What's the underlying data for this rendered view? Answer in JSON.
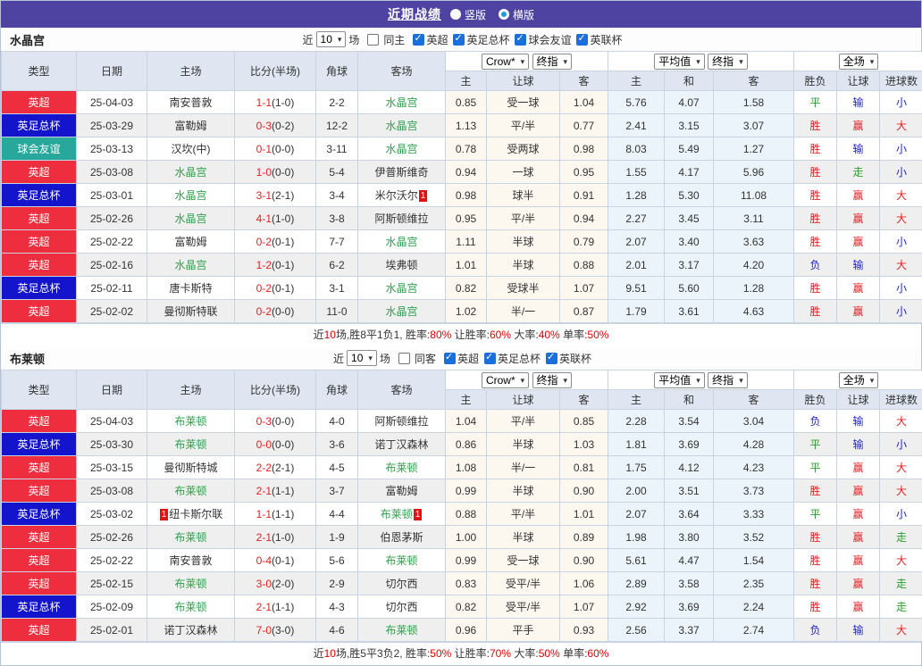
{
  "title_bar": {
    "title": "近期战绩",
    "radios": [
      {
        "label": "竖版",
        "selected": false
      },
      {
        "label": "横版",
        "selected": true
      }
    ]
  },
  "icons": {
    "chevron_down": "▾",
    "check": "✓"
  },
  "colors": {
    "topbar": "#4e43a0",
    "league_red": "#ee2e3e",
    "league_blue": "#1414cc",
    "league_teal": "#28a89c",
    "team_green": "#2fa04c",
    "score_red": "#e02222",
    "result_red": "#e02222",
    "result_blue": "#2222cc",
    "result_green": "#2d9b2d"
  },
  "header_selects": {
    "company": "Crow*",
    "stage1": "终指",
    "average": "平均值",
    "stage2": "终指",
    "scope": "全场"
  },
  "table_headers": {
    "main": [
      "类型",
      "日期",
      "主场",
      "比分(半场)",
      "角球",
      "客场"
    ],
    "ah": [
      "主",
      "让球",
      "客"
    ],
    "avg": [
      "主",
      "和",
      "客"
    ],
    "result": [
      "胜负",
      "让球",
      "进球数"
    ]
  },
  "filter_labels": {
    "near": "近",
    "games": "场"
  },
  "sections": [
    {
      "team": "水晶宫",
      "filters": {
        "count": "10",
        "same": {
          "label": "同主",
          "checked": false
        },
        "leagues": [
          {
            "label": "英超",
            "checked": true
          },
          {
            "label": "英足总杯",
            "checked": true
          },
          {
            "label": "球会友谊",
            "checked": true
          },
          {
            "label": "英联杯",
            "checked": true
          }
        ]
      },
      "rows": [
        {
          "league": "英超",
          "lc": "red",
          "date": "25-04-03",
          "home": "南安普敦",
          "hg": false,
          "hb": null,
          "score": "1-1",
          "half": "(1-0)",
          "corners": "2-2",
          "away": "水晶宫",
          "ag": true,
          "ab": null,
          "ah": [
            "0.85",
            "受一球",
            "1.04"
          ],
          "avg": [
            "5.76",
            "4.07",
            "1.58"
          ],
          "res": [
            [
              "平",
              "g"
            ],
            [
              "输",
              "b"
            ],
            [
              "小",
              "b"
            ]
          ]
        },
        {
          "league": "英足总杯",
          "lc": "blue",
          "date": "25-03-29",
          "home": "富勒姆",
          "hg": false,
          "hb": null,
          "score": "0-3",
          "half": "(0-2)",
          "corners": "12-2",
          "away": "水晶宫",
          "ag": true,
          "ab": null,
          "ah": [
            "1.13",
            "平/半",
            "0.77"
          ],
          "avg": [
            "2.41",
            "3.15",
            "3.07"
          ],
          "res": [
            [
              "胜",
              "r"
            ],
            [
              "赢",
              "r"
            ],
            [
              "大",
              "r"
            ]
          ]
        },
        {
          "league": "球会友谊",
          "lc": "teal",
          "date": "25-03-13",
          "home": "汉坎(中)",
          "hg": false,
          "hb": null,
          "score": "0-1",
          "half": "(0-0)",
          "corners": "3-11",
          "away": "水晶宫",
          "ag": true,
          "ab": null,
          "ah": [
            "0.78",
            "受两球",
            "0.98"
          ],
          "avg": [
            "8.03",
            "5.49",
            "1.27"
          ],
          "res": [
            [
              "胜",
              "r"
            ],
            [
              "输",
              "b"
            ],
            [
              "小",
              "b"
            ]
          ]
        },
        {
          "league": "英超",
          "lc": "red",
          "date": "25-03-08",
          "home": "水晶宫",
          "hg": true,
          "hb": null,
          "score": "1-0",
          "half": "(0-0)",
          "corners": "5-4",
          "away": "伊普斯维奇",
          "ag": false,
          "ab": null,
          "ah": [
            "0.94",
            "一球",
            "0.95"
          ],
          "avg": [
            "1.55",
            "4.17",
            "5.96"
          ],
          "res": [
            [
              "胜",
              "r"
            ],
            [
              "走",
              "g"
            ],
            [
              "小",
              "b"
            ]
          ]
        },
        {
          "league": "英足总杯",
          "lc": "blue",
          "date": "25-03-01",
          "home": "水晶宫",
          "hg": true,
          "hb": null,
          "score": "3-1",
          "half": "(2-1)",
          "corners": "3-4",
          "away": "米尔沃尔",
          "ag": false,
          "ab": "1",
          "ah": [
            "0.98",
            "球半",
            "0.91"
          ],
          "avg": [
            "1.28",
            "5.30",
            "11.08"
          ],
          "res": [
            [
              "胜",
              "r"
            ],
            [
              "赢",
              "r"
            ],
            [
              "大",
              "r"
            ]
          ]
        },
        {
          "league": "英超",
          "lc": "red",
          "date": "25-02-26",
          "home": "水晶宫",
          "hg": true,
          "hb": null,
          "score": "4-1",
          "half": "(1-0)",
          "corners": "3-8",
          "away": "阿斯顿维拉",
          "ag": false,
          "ab": null,
          "ah": [
            "0.95",
            "平/半",
            "0.94"
          ],
          "avg": [
            "2.27",
            "3.45",
            "3.11"
          ],
          "res": [
            [
              "胜",
              "r"
            ],
            [
              "赢",
              "r"
            ],
            [
              "大",
              "r"
            ]
          ]
        },
        {
          "league": "英超",
          "lc": "red",
          "date": "25-02-22",
          "home": "富勒姆",
          "hg": false,
          "hb": null,
          "score": "0-2",
          "half": "(0-1)",
          "corners": "7-7",
          "away": "水晶宫",
          "ag": true,
          "ab": null,
          "ah": [
            "1.11",
            "半球",
            "0.79"
          ],
          "avg": [
            "2.07",
            "3.40",
            "3.63"
          ],
          "res": [
            [
              "胜",
              "r"
            ],
            [
              "赢",
              "r"
            ],
            [
              "小",
              "b"
            ]
          ]
        },
        {
          "league": "英超",
          "lc": "red",
          "date": "25-02-16",
          "home": "水晶宫",
          "hg": true,
          "hb": null,
          "score": "1-2",
          "half": "(0-1)",
          "corners": "6-2",
          "away": "埃弗顿",
          "ag": false,
          "ab": null,
          "ah": [
            "1.01",
            "半球",
            "0.88"
          ],
          "avg": [
            "2.01",
            "3.17",
            "4.20"
          ],
          "res": [
            [
              "负",
              "b"
            ],
            [
              "输",
              "b"
            ],
            [
              "大",
              "r"
            ]
          ]
        },
        {
          "league": "英足总杯",
          "lc": "blue",
          "date": "25-02-11",
          "home": "唐卡斯特",
          "hg": false,
          "hb": null,
          "score": "0-2",
          "half": "(0-1)",
          "corners": "3-1",
          "away": "水晶宫",
          "ag": true,
          "ab": null,
          "ah": [
            "0.82",
            "受球半",
            "1.07"
          ],
          "avg": [
            "9.51",
            "5.60",
            "1.28"
          ],
          "res": [
            [
              "胜",
              "r"
            ],
            [
              "赢",
              "r"
            ],
            [
              "小",
              "b"
            ]
          ]
        },
        {
          "league": "英超",
          "lc": "red",
          "date": "25-02-02",
          "home": "曼彻斯特联",
          "hg": false,
          "hb": null,
          "score": "0-2",
          "half": "(0-0)",
          "corners": "11-0",
          "away": "水晶宫",
          "ag": true,
          "ab": null,
          "ah": [
            "1.02",
            "半/一",
            "0.87"
          ],
          "avg": [
            "1.79",
            "3.61",
            "4.63"
          ],
          "res": [
            [
              "胜",
              "r"
            ],
            [
              "赢",
              "r"
            ],
            [
              "小",
              "b"
            ]
          ]
        }
      ],
      "summary": [
        [
          "近",
          ""
        ],
        [
          "10",
          "r"
        ],
        [
          "场,胜8平1负1, 胜率:",
          ""
        ],
        [
          "80%",
          "r"
        ],
        [
          " 让胜率:",
          ""
        ],
        [
          "60%",
          "r"
        ],
        [
          " 大率:",
          ""
        ],
        [
          "40%",
          "r"
        ],
        [
          " 单率:",
          ""
        ],
        [
          "50%",
          "r"
        ]
      ]
    },
    {
      "team": "布莱顿",
      "filters": {
        "count": "10",
        "same": {
          "label": "同客",
          "checked": false
        },
        "leagues": [
          {
            "label": "英超",
            "checked": true
          },
          {
            "label": "英足总杯",
            "checked": true
          },
          {
            "label": "英联杯",
            "checked": true
          }
        ]
      },
      "rows": [
        {
          "league": "英超",
          "lc": "red",
          "date": "25-04-03",
          "home": "布莱顿",
          "hg": true,
          "hb": null,
          "score": "0-3",
          "half": "(0-0)",
          "corners": "4-0",
          "away": "阿斯顿维拉",
          "ag": false,
          "ab": null,
          "ah": [
            "1.04",
            "平/半",
            "0.85"
          ],
          "avg": [
            "2.28",
            "3.54",
            "3.04"
          ],
          "res": [
            [
              "负",
              "b"
            ],
            [
              "输",
              "b"
            ],
            [
              "大",
              "r"
            ]
          ]
        },
        {
          "league": "英足总杯",
          "lc": "blue",
          "date": "25-03-30",
          "home": "布莱顿",
          "hg": true,
          "hb": null,
          "score": "0-0",
          "half": "(0-0)",
          "corners": "3-6",
          "away": "诺丁汉森林",
          "ag": false,
          "ab": null,
          "ah": [
            "0.86",
            "半球",
            "1.03"
          ],
          "avg": [
            "1.81",
            "3.69",
            "4.28"
          ],
          "res": [
            [
              "平",
              "g"
            ],
            [
              "输",
              "b"
            ],
            [
              "小",
              "b"
            ]
          ]
        },
        {
          "league": "英超",
          "lc": "red",
          "date": "25-03-15",
          "home": "曼彻斯特城",
          "hg": false,
          "hb": null,
          "score": "2-2",
          "half": "(2-1)",
          "corners": "4-5",
          "away": "布莱顿",
          "ag": true,
          "ab": null,
          "ah": [
            "1.08",
            "半/一",
            "0.81"
          ],
          "avg": [
            "1.75",
            "4.12",
            "4.23"
          ],
          "res": [
            [
              "平",
              "g"
            ],
            [
              "赢",
              "r"
            ],
            [
              "大",
              "r"
            ]
          ]
        },
        {
          "league": "英超",
          "lc": "red",
          "date": "25-03-08",
          "home": "布莱顿",
          "hg": true,
          "hb": null,
          "score": "2-1",
          "half": "(1-1)",
          "corners": "3-7",
          "away": "富勒姆",
          "ag": false,
          "ab": null,
          "ah": [
            "0.99",
            "半球",
            "0.90"
          ],
          "avg": [
            "2.00",
            "3.51",
            "3.73"
          ],
          "res": [
            [
              "胜",
              "r"
            ],
            [
              "赢",
              "r"
            ],
            [
              "大",
              "r"
            ]
          ]
        },
        {
          "league": "英足总杯",
          "lc": "blue",
          "date": "25-03-02",
          "home": "纽卡斯尔联",
          "hg": false,
          "hb": "1",
          "score": "1-1",
          "half": "(1-1)",
          "corners": "4-4",
          "away": "布莱顿",
          "ag": true,
          "ab": "1",
          "ah": [
            "0.88",
            "平/半",
            "1.01"
          ],
          "avg": [
            "2.07",
            "3.64",
            "3.33"
          ],
          "res": [
            [
              "平",
              "g"
            ],
            [
              "赢",
              "r"
            ],
            [
              "小",
              "b"
            ]
          ]
        },
        {
          "league": "英超",
          "lc": "red",
          "date": "25-02-26",
          "home": "布莱顿",
          "hg": true,
          "hb": null,
          "score": "2-1",
          "half": "(1-0)",
          "corners": "1-9",
          "away": "伯恩茅斯",
          "ag": false,
          "ab": null,
          "ah": [
            "1.00",
            "半球",
            "0.89"
          ],
          "avg": [
            "1.98",
            "3.80",
            "3.52"
          ],
          "res": [
            [
              "胜",
              "r"
            ],
            [
              "赢",
              "r"
            ],
            [
              "走",
              "g"
            ]
          ]
        },
        {
          "league": "英超",
          "lc": "red",
          "date": "25-02-22",
          "home": "南安普敦",
          "hg": false,
          "hb": null,
          "score": "0-4",
          "half": "(0-1)",
          "corners": "5-6",
          "away": "布莱顿",
          "ag": true,
          "ab": null,
          "ah": [
            "0.99",
            "受一球",
            "0.90"
          ],
          "avg": [
            "5.61",
            "4.47",
            "1.54"
          ],
          "res": [
            [
              "胜",
              "r"
            ],
            [
              "赢",
              "r"
            ],
            [
              "大",
              "r"
            ]
          ]
        },
        {
          "league": "英超",
          "lc": "red",
          "date": "25-02-15",
          "home": "布莱顿",
          "hg": true,
          "hb": null,
          "score": "3-0",
          "half": "(2-0)",
          "corners": "2-9",
          "away": "切尔西",
          "ag": false,
          "ab": null,
          "ah": [
            "0.83",
            "受平/半",
            "1.06"
          ],
          "avg": [
            "2.89",
            "3.58",
            "2.35"
          ],
          "res": [
            [
              "胜",
              "r"
            ],
            [
              "赢",
              "r"
            ],
            [
              "走",
              "g"
            ]
          ]
        },
        {
          "league": "英足总杯",
          "lc": "blue",
          "date": "25-02-09",
          "home": "布莱顿",
          "hg": true,
          "hb": null,
          "score": "2-1",
          "half": "(1-1)",
          "corners": "4-3",
          "away": "切尔西",
          "ag": false,
          "ab": null,
          "ah": [
            "0.82",
            "受平/半",
            "1.07"
          ],
          "avg": [
            "2.92",
            "3.69",
            "2.24"
          ],
          "res": [
            [
              "胜",
              "r"
            ],
            [
              "赢",
              "r"
            ],
            [
              "走",
              "g"
            ]
          ]
        },
        {
          "league": "英超",
          "lc": "red",
          "date": "25-02-01",
          "home": "诺丁汉森林",
          "hg": false,
          "hb": null,
          "score": "7-0",
          "half": "(3-0)",
          "corners": "4-6",
          "away": "布莱顿",
          "ag": true,
          "ab": null,
          "ah": [
            "0.96",
            "平手",
            "0.93"
          ],
          "avg": [
            "2.56",
            "3.37",
            "2.74"
          ],
          "res": [
            [
              "负",
              "b"
            ],
            [
              "输",
              "b"
            ],
            [
              "大",
              "r"
            ]
          ]
        }
      ],
      "summary": [
        [
          "近",
          ""
        ],
        [
          "10",
          "r"
        ],
        [
          "场,胜5平3负2, 胜率:",
          ""
        ],
        [
          "50%",
          "r"
        ],
        [
          " 让胜率:",
          ""
        ],
        [
          "70%",
          "r"
        ],
        [
          " 大率:",
          ""
        ],
        [
          "50%",
          "r"
        ],
        [
          " 单率:",
          ""
        ],
        [
          "60%",
          "r"
        ]
      ]
    }
  ]
}
